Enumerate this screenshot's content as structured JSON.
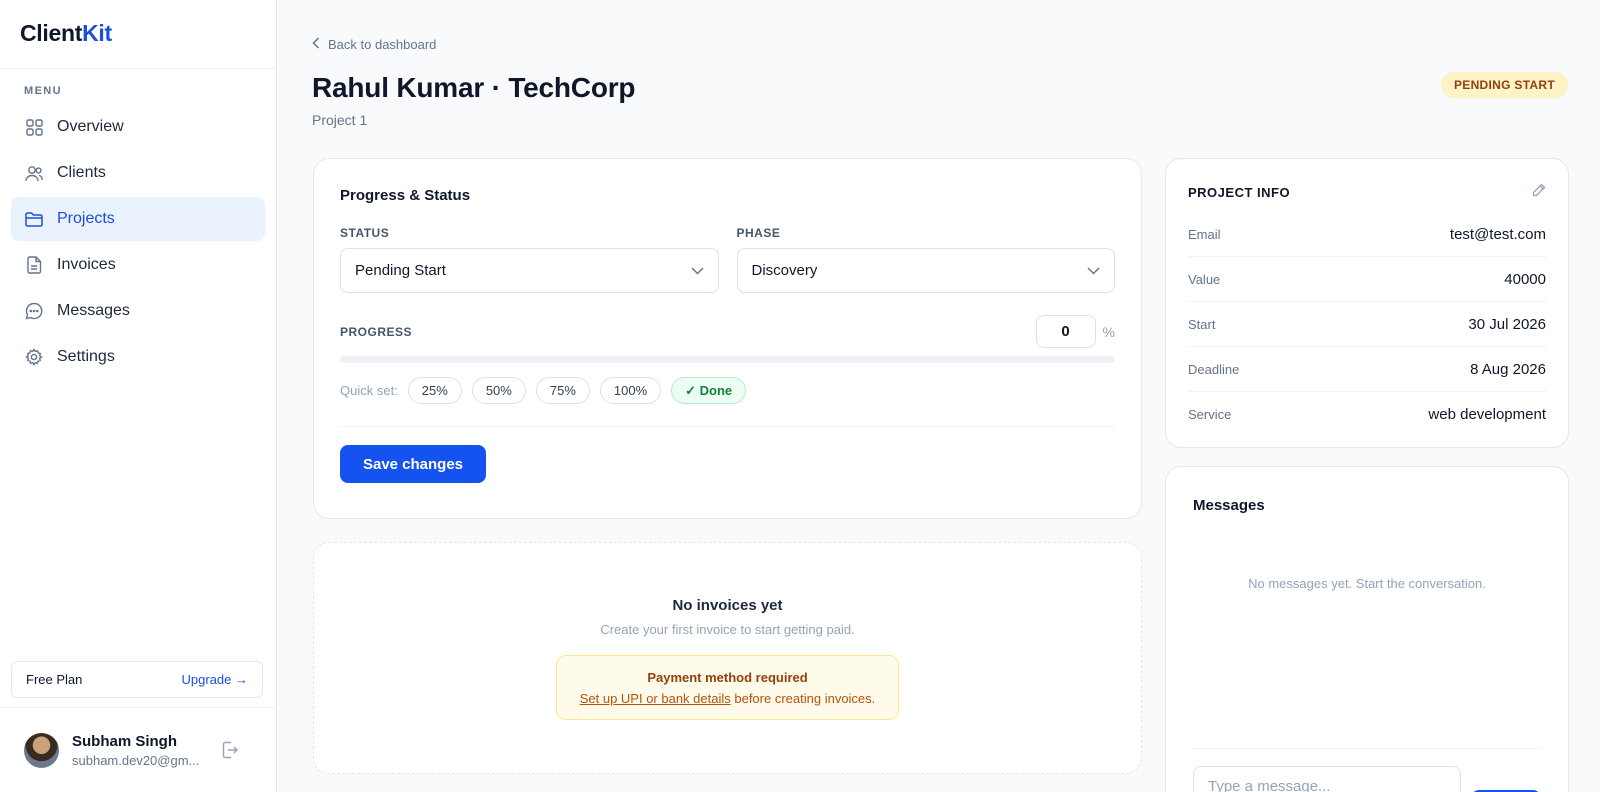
{
  "brand": {
    "part1": "Client",
    "part2": "Kit"
  },
  "sidebar": {
    "menu_label": "MENU",
    "items": [
      {
        "label": "Overview",
        "icon": "grid-icon"
      },
      {
        "label": "Clients",
        "icon": "users-icon"
      },
      {
        "label": "Projects",
        "icon": "folder-icon",
        "active": true
      },
      {
        "label": "Invoices",
        "icon": "file-icon"
      },
      {
        "label": "Messages",
        "icon": "chat-icon"
      },
      {
        "label": "Settings",
        "icon": "gear-icon"
      }
    ],
    "plan": {
      "name": "Free Plan",
      "upgrade": "Upgrade →"
    },
    "user": {
      "name": "Subham Singh",
      "email": "subham.dev20@gm..."
    }
  },
  "header": {
    "back": "Back to dashboard",
    "title": "Rahul Kumar · TechCorp",
    "subtitle": "Project 1",
    "status_badge": "PENDING START"
  },
  "progress_card": {
    "title": "Progress & Status",
    "status_label": "STATUS",
    "status_value": "Pending Start",
    "phase_label": "PHASE",
    "phase_value": "Discovery",
    "progress_label": "PROGRESS",
    "progress_value": "0",
    "progress_unit": "%",
    "progress_fraction": 0,
    "quick_set_label": "Quick set:",
    "quick_chips": [
      "25%",
      "50%",
      "75%",
      "100%"
    ],
    "done_chip": "✓ Done",
    "save_label": "Save changes"
  },
  "invoices": {
    "empty_title": "No invoices yet",
    "empty_sub": "Create your first invoice to start getting paid.",
    "warning_title": "Payment method required",
    "warning_link": "Set up UPI or bank details",
    "warning_rest": " before creating invoices."
  },
  "project_info": {
    "title": "PROJECT INFO",
    "rows": [
      {
        "key": "Email",
        "value": "test@test.com"
      },
      {
        "key": "Value",
        "value": "40000"
      },
      {
        "key": "Start",
        "value": "30 Jul 2026"
      },
      {
        "key": "Deadline",
        "value": "8 Aug 2026"
      },
      {
        "key": "Service",
        "value": "web development"
      }
    ]
  },
  "messages": {
    "title": "Messages",
    "empty": "No messages yet. Start the conversation.",
    "input_placeholder": "Type a message..."
  },
  "colors": {
    "accent": "#1553f0",
    "badge_bg": "#fdf3c7",
    "badge_text": "#92400e",
    "done_green": "#15803d"
  }
}
